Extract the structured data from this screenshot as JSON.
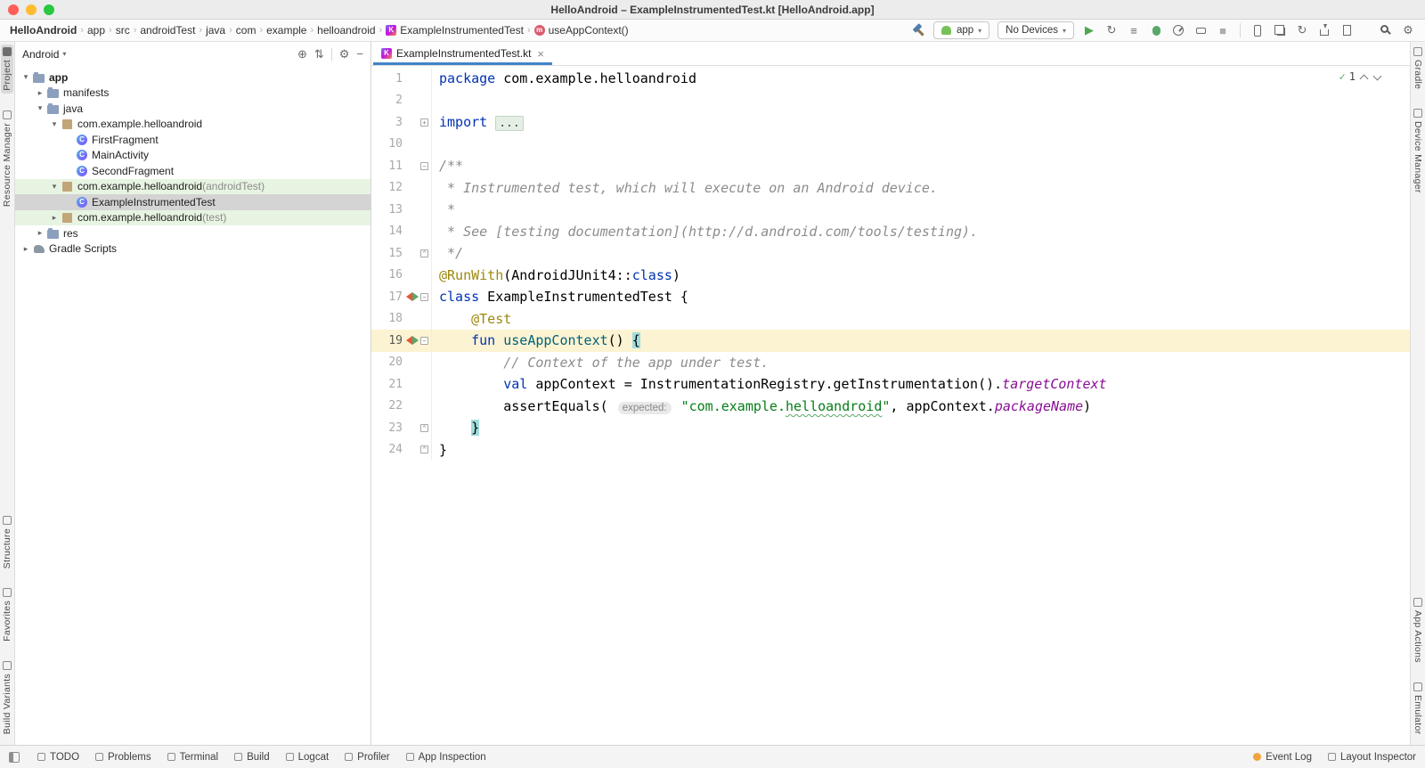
{
  "colors": {
    "keyword": "#0033B3",
    "string": "#067D17",
    "comment": "#8C8C8C",
    "annotation": "#9E880D",
    "function_decl": "#00627A",
    "property": "#871094",
    "line_number": "#A9A9A9",
    "current_line_bg": "#FBF3D2",
    "brace_match_bg": "#A3DCDC",
    "test_dir_bg": "#E8F4E2",
    "selection_bg": "#D4D4D4",
    "tab_accent": "#4083C9",
    "run_green": "#59A869",
    "event_log_dot": "#F2A33C"
  },
  "titlebar": {
    "title": "HelloAndroid – ExampleInstrumentedTest.kt [HelloAndroid.app]"
  },
  "breadcrumbs": [
    {
      "label": "HelloAndroid"
    },
    {
      "label": "app"
    },
    {
      "label": "src"
    },
    {
      "label": "androidTest"
    },
    {
      "label": "java"
    },
    {
      "label": "com"
    },
    {
      "label": "example"
    },
    {
      "label": "helloandroid"
    },
    {
      "label": "ExampleInstrumentedTest",
      "icon": "kotlin-file"
    },
    {
      "label": "useAppContext()",
      "icon": "method"
    }
  ],
  "toolbar": {
    "hammer": {
      "name": "build-hammer-icon",
      "css": "hammer"
    },
    "run_config": {
      "label": "app"
    },
    "device_selector": {
      "label": "No Devices"
    },
    "run_actions": [
      {
        "name": "run-icon",
        "glyph": "▶",
        "color": "#4FA84F"
      },
      {
        "name": "apply-changes-icon",
        "glyph": "↻",
        "color": "#6A6A6A"
      },
      {
        "name": "apply-code-changes-icon",
        "glyph": "≡",
        "color": "#6A6A6A"
      },
      {
        "name": "debug-icon",
        "css": "bug"
      },
      {
        "name": "profile-icon",
        "css": "gauge"
      },
      {
        "name": "attach-debugger-icon",
        "css": "attach"
      },
      {
        "name": "stop-icon",
        "glyph": "■",
        "color": "#A9AEB3"
      }
    ],
    "tool_actions": [
      {
        "name": "device-manager-icon",
        "css": "phone"
      },
      {
        "name": "layout-inspector-icon",
        "css": "layers"
      },
      {
        "name": "sync-gradle-icon",
        "glyph": "↻",
        "color": "#6A6A6A"
      },
      {
        "name": "sdk-manager-icon",
        "css": "download"
      },
      {
        "name": "logcat-icon",
        "css": "doc"
      }
    ],
    "right_icons": [
      {
        "name": "search-everywhere-icon",
        "css": "search"
      },
      {
        "name": "settings-gear-icon",
        "glyph": "⚙",
        "color": "#6A6A6A"
      }
    ]
  },
  "project": {
    "view": "Android",
    "header_icons": [
      {
        "name": "locate-file-icon",
        "glyph": "⊕"
      },
      {
        "name": "expand-collapse-icon",
        "glyph": "⇅"
      },
      {
        "divider": true
      },
      {
        "name": "project-options-icon",
        "glyph": "⚙"
      },
      {
        "name": "hide-panel-icon",
        "glyph": "−"
      }
    ],
    "tree": [
      {
        "label": "app",
        "depth": 0,
        "chev": "▾",
        "icon": "folder",
        "bold": true
      },
      {
        "label": "manifests",
        "depth": 1,
        "chev": "▸",
        "icon": "folder"
      },
      {
        "label": "java",
        "depth": 1,
        "chev": "▾",
        "icon": "folder"
      },
      {
        "label": "com.example.helloandroid",
        "depth": 2,
        "chev": "▾",
        "icon": "package"
      },
      {
        "label": "FirstFragment",
        "depth": 3,
        "chev": "",
        "icon": "kclass"
      },
      {
        "label": "MainActivity",
        "depth": 3,
        "chev": "",
        "icon": "kclass"
      },
      {
        "label": "SecondFragment",
        "depth": 3,
        "chev": "",
        "icon": "kclass"
      },
      {
        "label": "com.example.helloandroid",
        "suffix": " (androidTest)",
        "depth": 2,
        "chev": "▾",
        "icon": "package",
        "bg": "green"
      },
      {
        "label": "ExampleInstrumentedTest",
        "depth": 3,
        "chev": "",
        "icon": "kclass",
        "bg": "selected"
      },
      {
        "label": "com.example.helloandroid",
        "suffix": " (test)",
        "depth": 2,
        "chev": "▸",
        "icon": "package",
        "bg": "green"
      },
      {
        "label": "res",
        "depth": 1,
        "chev": "▸",
        "icon": "folder"
      },
      {
        "label": "Gradle Scripts",
        "depth": 0,
        "chev": "▸",
        "icon": "gradle"
      }
    ]
  },
  "editor": {
    "tab": "ExampleInstrumentedTest.kt",
    "inspection_count": "1",
    "lines": [
      {
        "n": "1",
        "t": [
          [
            "kw",
            "package"
          ],
          [
            "pl",
            " com.example.helloandroid"
          ]
        ]
      },
      {
        "n": "2",
        "t": []
      },
      {
        "n": "3",
        "f": "plus",
        "t": [
          [
            "kw",
            "import"
          ],
          [
            "pl",
            " "
          ],
          [
            "fold",
            "..."
          ]
        ]
      },
      {
        "n": "10",
        "t": []
      },
      {
        "n": "11",
        "f": "minus",
        "t": [
          [
            "com",
            "/**"
          ]
        ]
      },
      {
        "n": "12",
        "t": [
          [
            "com",
            " * Instrumented test, which will execute on an Android device."
          ]
        ]
      },
      {
        "n": "13",
        "t": [
          [
            "com",
            " *"
          ]
        ]
      },
      {
        "n": "14",
        "t": [
          [
            "com",
            " * See [testing documentation](http://d.android.com/tools/testing)."
          ]
        ]
      },
      {
        "n": "15",
        "f": "end",
        "t": [
          [
            "com",
            " */"
          ]
        ]
      },
      {
        "n": "16",
        "t": [
          [
            "ann",
            "@RunWith"
          ],
          [
            "pl",
            "(AndroidJUnit4::"
          ],
          [
            "kw",
            "class"
          ],
          [
            "pl",
            ")"
          ]
        ]
      },
      {
        "n": "17",
        "f": "minus",
        "run": true,
        "t": [
          [
            "kw",
            "class"
          ],
          [
            "pl",
            " ExampleInstrumentedTest {"
          ]
        ]
      },
      {
        "n": "18",
        "t": [
          [
            "pl",
            "    "
          ],
          [
            "ann",
            "@Test"
          ]
        ]
      },
      {
        "n": "19",
        "f": "minus",
        "run": true,
        "current": true,
        "t": [
          [
            "pl",
            "    "
          ],
          [
            "kw",
            "fun"
          ],
          [
            "pl",
            " "
          ],
          [
            "fn",
            "useAppContext"
          ],
          [
            "pl",
            "() "
          ],
          [
            "brace",
            "{"
          ]
        ]
      },
      {
        "n": "20",
        "t": [
          [
            "pl",
            "        "
          ],
          [
            "com",
            "// Context of the app under test."
          ]
        ]
      },
      {
        "n": "21",
        "t": [
          [
            "pl",
            "        "
          ],
          [
            "kw",
            "val"
          ],
          [
            "pl",
            " appContext = InstrumentationRegistry.getInstrumentation()."
          ],
          [
            "prop",
            "targetContext"
          ]
        ]
      },
      {
        "n": "22",
        "t": [
          [
            "pl",
            "        assertEquals( "
          ],
          [
            "hint",
            "expected:"
          ],
          [
            "pl",
            " "
          ],
          [
            "str",
            "\"com.example."
          ],
          [
            "strwavy",
            "helloandroid"
          ],
          [
            "str",
            "\""
          ],
          [
            "pl",
            ", appContext."
          ],
          [
            "prop",
            "packageName"
          ],
          [
            "pl",
            ")"
          ]
        ]
      },
      {
        "n": "23",
        "f": "end",
        "t": [
          [
            "pl",
            "    "
          ],
          [
            "brace",
            "}"
          ]
        ]
      },
      {
        "n": "24",
        "f": "end",
        "t": [
          [
            "pl",
            "}"
          ]
        ]
      }
    ]
  },
  "left_strip": {
    "top": [
      {
        "label": "Project",
        "active": true
      },
      {
        "label": "Resource Manager"
      }
    ],
    "bottom": [
      {
        "label": "Structure"
      },
      {
        "label": "Favorites"
      },
      {
        "label": "Build Variants"
      }
    ]
  },
  "right_strip": {
    "top": [
      {
        "label": "Gradle"
      },
      {
        "label": "Device Manager"
      }
    ],
    "bottom": [
      {
        "label": "App Actions"
      },
      {
        "label": "Emulator"
      }
    ]
  },
  "statusbar": {
    "left": [
      {
        "label": "TODO"
      },
      {
        "label": "Problems"
      },
      {
        "label": "Terminal"
      },
      {
        "label": "Build"
      },
      {
        "label": "Logcat"
      },
      {
        "label": "Profiler"
      },
      {
        "label": "App Inspection"
      }
    ],
    "right": [
      {
        "label": "Event Log",
        "dot": "#F2A33C"
      },
      {
        "label": "Layout Inspector"
      }
    ]
  }
}
